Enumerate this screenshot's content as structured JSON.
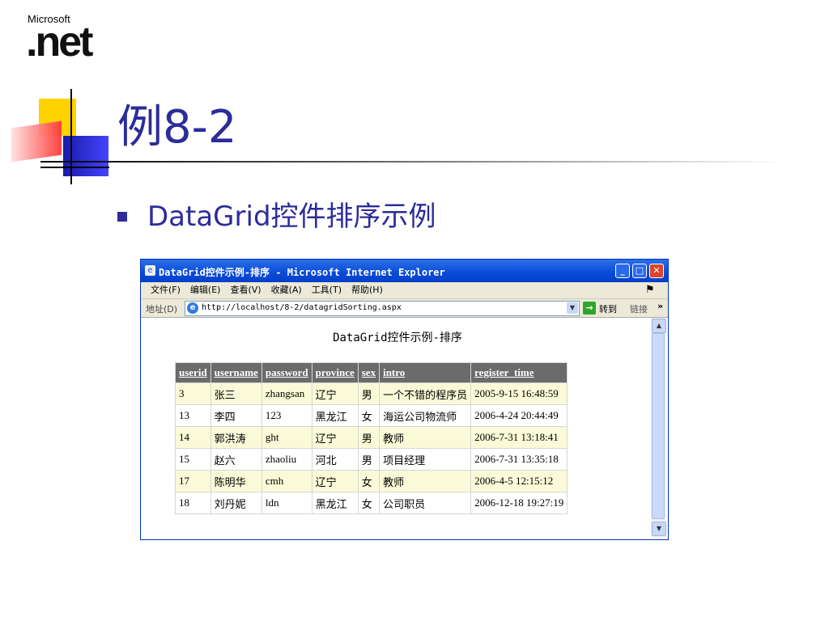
{
  "logo": {
    "brand": "Microsoft",
    "product": ".net"
  },
  "slide": {
    "title": "例8-2",
    "bullet": "DataGrid控件排序示例"
  },
  "browser": {
    "window_title": "DataGrid控件示例-排序 - Microsoft Internet Explorer",
    "menu": [
      "文件(F)",
      "编辑(E)",
      "查看(V)",
      "收藏(A)",
      "工具(T)",
      "帮助(H)"
    ],
    "address_label": "地址(D)",
    "url": "http://localhost/8-2/datagridSorting.aspx",
    "go_label": "转到",
    "links_label": "链接",
    "more": "»",
    "page_heading": "DataGrid控件示例-排序",
    "grid": {
      "columns": [
        "userid",
        "username",
        "password",
        "province",
        "sex",
        "intro",
        "register_time"
      ],
      "rows": [
        [
          "3",
          "张三",
          "zhangsan",
          "辽宁",
          "男",
          "一个不错的程序员",
          "2005-9-15 16:48:59"
        ],
        [
          "13",
          "李四",
          "123",
          "黑龙江",
          "女",
          "海运公司物流师",
          "2006-4-24 20:44:49"
        ],
        [
          "14",
          "郭洪涛",
          "ght",
          "辽宁",
          "男",
          "教师",
          "2006-7-31 13:18:41"
        ],
        [
          "15",
          "赵六",
          "zhaoliu",
          "河北",
          "男",
          "项目经理",
          "2006-7-31 13:35:18"
        ],
        [
          "17",
          "陈明华",
          "cmh",
          "辽宁",
          "女",
          "教师",
          "2006-4-5 12:15:12"
        ],
        [
          "18",
          "刘丹妮",
          "ldn",
          "黑龙江",
          "女",
          "公司职员",
          "2006-12-18 19:27:19"
        ]
      ]
    }
  },
  "colors": {
    "title": "#2c2c9a",
    "header_bg": "#6b6b6b",
    "row_alt": "#fafad8"
  }
}
